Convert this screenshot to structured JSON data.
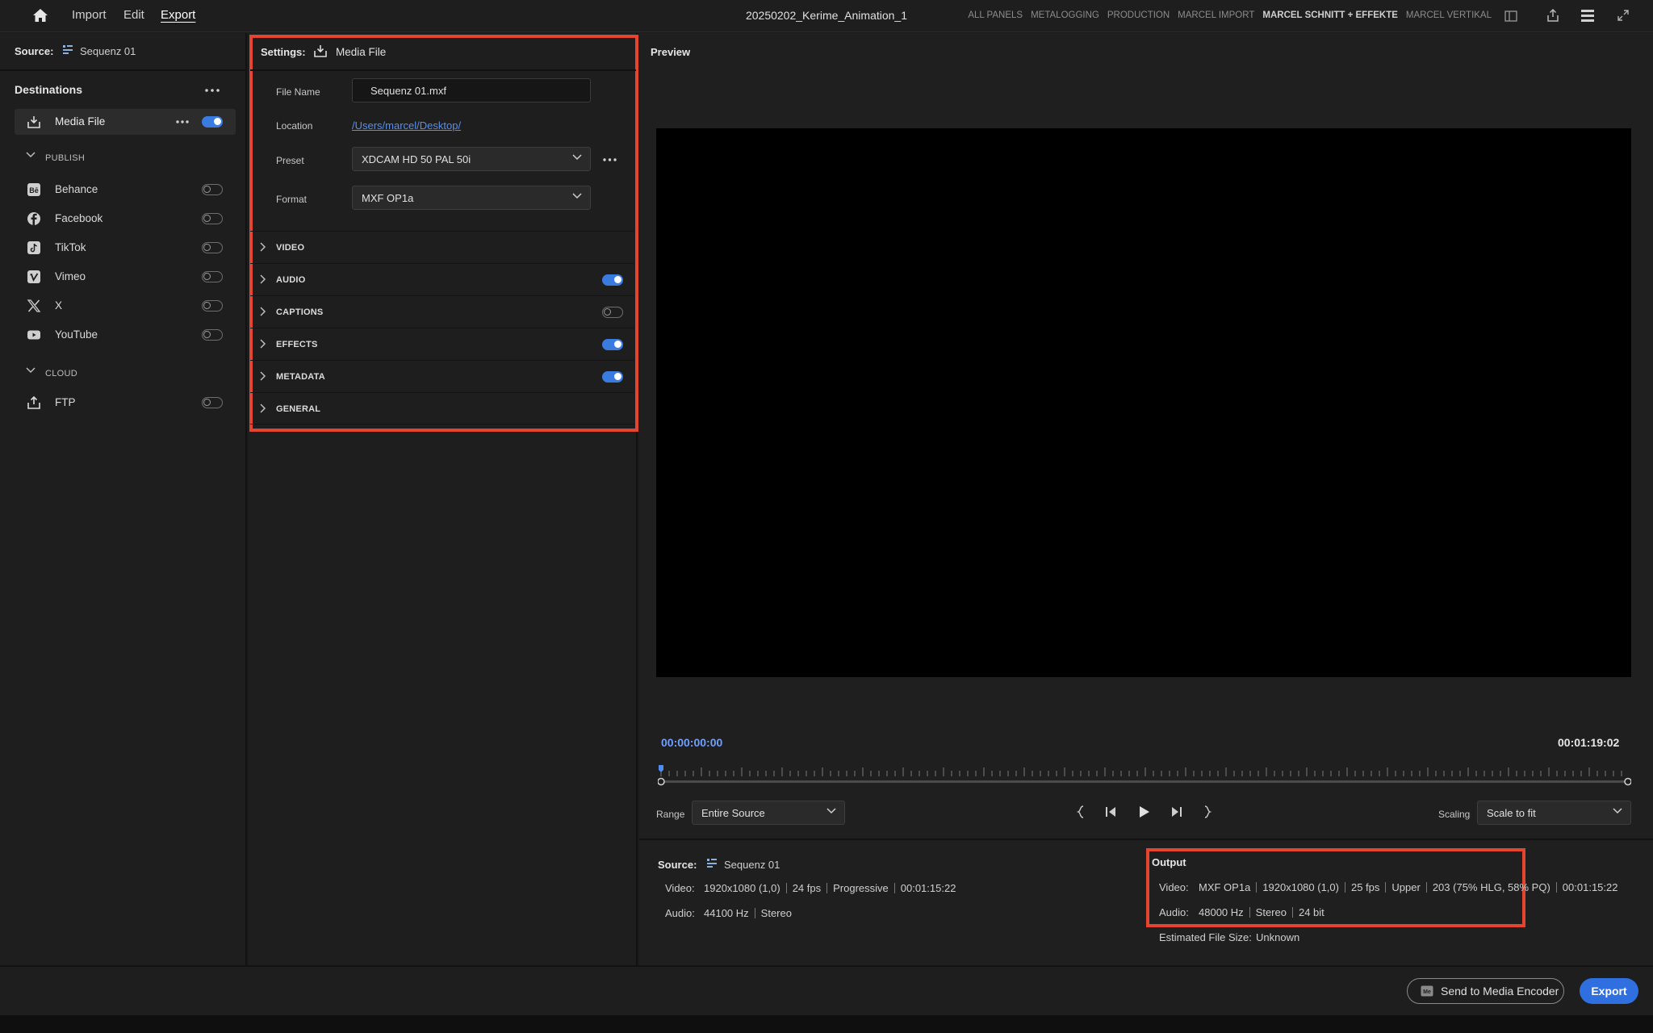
{
  "topbar": {
    "menu": [
      "Import",
      "Edit",
      "Export"
    ],
    "title": "20250202_Kerime_Animation_1",
    "workspaces": [
      "ALL PANELS",
      "METALOGGING",
      "PRODUCTION",
      "MARCEL IMPORT",
      "MARCEL SCHNITT + EFFEKTE",
      "MARCEL VERTIKAL"
    ],
    "active_workspace_index": 4
  },
  "left": {
    "source_label": "Source:",
    "source_name": "Sequenz 01",
    "destinations_title": "Destinations",
    "media_file": {
      "label": "Media File",
      "enabled": true
    },
    "publish_header": "PUBLISH",
    "publish": [
      {
        "label": "Behance",
        "icon": "behance-icon",
        "enabled": false
      },
      {
        "label": "Facebook",
        "icon": "facebook-icon",
        "enabled": false
      },
      {
        "label": "TikTok",
        "icon": "tiktok-icon",
        "enabled": false
      },
      {
        "label": "Vimeo",
        "icon": "vimeo-icon",
        "enabled": false
      },
      {
        "label": "X",
        "icon": "x-icon",
        "enabled": false
      },
      {
        "label": "YouTube",
        "icon": "youtube-icon",
        "enabled": false
      }
    ],
    "cloud_header": "CLOUD",
    "cloud": [
      {
        "label": "FTP",
        "icon": "ftp-upload-icon",
        "enabled": false
      }
    ]
  },
  "settings": {
    "title": "Settings:",
    "target": "Media File",
    "file_name_label": "File Name",
    "file_name": "Sequenz 01.mxf",
    "location_label": "Location",
    "location": "/Users/marcel/Desktop/",
    "preset_label": "Preset",
    "preset": "XDCAM HD 50 PAL 50i",
    "format_label": "Format",
    "format": "MXF OP1a",
    "sections": [
      {
        "label": "VIDEO",
        "toggle": null
      },
      {
        "label": "AUDIO",
        "toggle": true
      },
      {
        "label": "CAPTIONS",
        "toggle": false
      },
      {
        "label": "EFFECTS",
        "toggle": true
      },
      {
        "label": "METADATA",
        "toggle": true
      },
      {
        "label": "GENERAL",
        "toggle": null
      }
    ]
  },
  "preview": {
    "title": "Preview",
    "timecode_current": "00:00:00:00",
    "timecode_duration": "00:01:19:02",
    "range_label": "Range",
    "range_value": "Entire Source",
    "scaling_label": "Scaling",
    "scaling_value": "Scale to fit"
  },
  "source_info": {
    "label": "Source:",
    "name": "Sequenz 01",
    "video_label": "Video:",
    "video": [
      "1920x1080 (1,0)",
      "24 fps",
      "Progressive",
      "00:01:15:22"
    ],
    "audio_label": "Audio:",
    "audio": [
      "44100 Hz",
      "Stereo"
    ]
  },
  "output_info": {
    "label": "Output",
    "video_label": "Video:",
    "video": [
      "MXF OP1a",
      "1920x1080 (1,0)",
      "25 fps",
      "Upper",
      "203 (75% HLG, 58% PQ)"
    ],
    "video_duration": "00:01:15:22",
    "audio_label": "Audio:",
    "audio": [
      "48000 Hz",
      "Stereo",
      "24 bit"
    ],
    "size_label": "Estimated File Size:",
    "size_value": "Unknown"
  },
  "footer": {
    "send_button": "Send to Media Encoder",
    "export_button": "Export"
  },
  "colors": {
    "accent": "#2f6fe0",
    "timecode": "#6fa0ff",
    "highlight": "#e5452f"
  }
}
